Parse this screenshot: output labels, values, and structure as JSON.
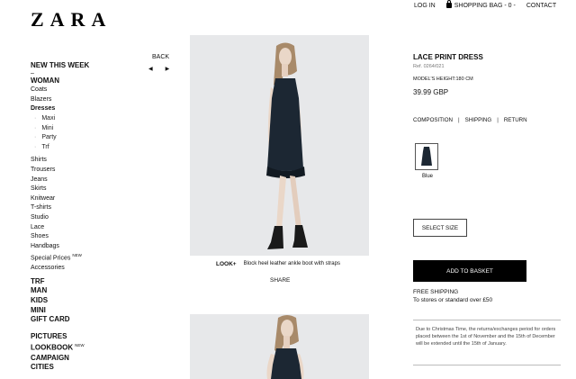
{
  "brand": "ZARA",
  "topnav": {
    "login": "LOG IN",
    "bag": "SHOPPING BAG - 0 -",
    "contact": "CONTACT"
  },
  "sidebar": {
    "new_this_week": "NEW THIS WEEK",
    "dash": "–",
    "woman": "WOMAN",
    "coats": "Coats",
    "blazers": "Blazers",
    "dresses": "Dresses",
    "maxi": "Maxi",
    "mini": "Mini",
    "party": "Party",
    "trf_sub": "Trf",
    "shirts": "Shirts",
    "trousers": "Trousers",
    "jeans": "Jeans",
    "skirts": "Skirts",
    "knitwear": "Knitwear",
    "tshirts": "T-shirts",
    "studio": "Studio",
    "lace": "Lace",
    "shoes": "Shoes",
    "handbags": "Handbags",
    "special_prices": "Special Prices",
    "new_badge": "NEW",
    "accessories": "Accessories",
    "trf": "TRF",
    "man": "MAN",
    "kids": "KIDS",
    "mini_section": "MINI",
    "gift_card": "GIFT CARD",
    "pictures": "PICTURES",
    "lookbook": "LOOKBOOK",
    "lookbook_badge": "NEW",
    "campaign": "CAMPAIGN",
    "cities": "CITIES"
  },
  "pager": {
    "back": "BACK",
    "prev": "◀",
    "next": "▶"
  },
  "look": {
    "label": "LOOK+",
    "text": "Block heel leather ankle boot with straps"
  },
  "share": "SHARE",
  "product": {
    "name": "LACE PRINT DRESS",
    "ref": "Ref. 0264/021",
    "model_height": "MODEL'S HEIGHT:180 CM",
    "price": "39.99 GBP",
    "composition": "COMPOSITION",
    "shipping": "SHIPPING",
    "returns": "RETURN",
    "separator": "|",
    "color": "Blue",
    "select_size": "SELECT SIZE",
    "add_to_basket": "ADD TO BASKET",
    "free_shipping": "FREE SHIPPING",
    "free_shipping_detail": "To stores or standard over £50",
    "notice": "Due to Christmas Time, the returns/exchanges period for orders placed between the 1st of November and the 15th of December will be extended until the 15th of January."
  },
  "colors": {
    "dress": "#1c2733",
    "photo_bg": "#e7e8ea",
    "button_bg": "#000000"
  }
}
